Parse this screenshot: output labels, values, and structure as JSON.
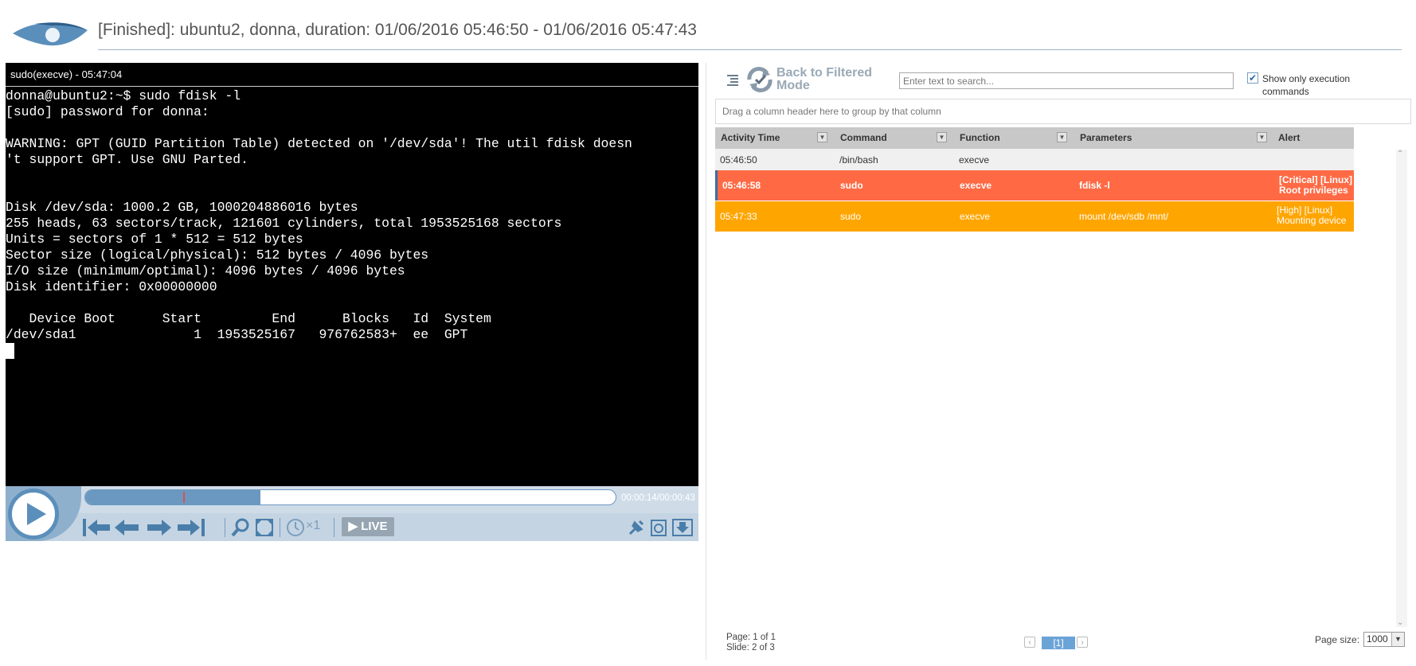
{
  "header": {
    "title": "[Finished]: ubuntu2, donna, duration: 01/06/2016 05:46:50 - 01/06/2016 05:47:43"
  },
  "player": {
    "titlebar": "sudo(execve) - 05:47:04",
    "terminal_text": "donna@ubuntu2:~$ sudo fdisk -l\n[sudo] password for donna:\n\nWARNING: GPT (GUID Partition Table) detected on '/dev/sda'! The util fdisk doesn\n't support GPT. Use GNU Parted.\n\n\nDisk /dev/sda: 1000.2 GB, 1000204886016 bytes\n255 heads, 63 sectors/track, 121601 cylinders, total 1953525168 sectors\nUnits = sectors of 1 * 512 = 512 bytes\nSector size (logical/physical): 512 bytes / 4096 bytes\nI/O size (minimum/optimal): 4096 bytes / 4096 bytes\nDisk identifier: 0x00000000\n\n   Device Boot      Start         End      Blocks   Id  System\n/dev/sda1               1  1953525167   976762583+  ee  GPT",
    "time": "00:00:14/00:00:43",
    "progress": 0.33,
    "speed": "×1",
    "live_label": "LIVE",
    "icons": [
      "play-icon",
      "skip-to-start-icon",
      "step-back-icon",
      "step-forward-icon",
      "skip-to-end-icon",
      "zoom-icon",
      "fullscreen-icon",
      "speed-clock-icon",
      "live-icon",
      "pin-icon",
      "screenshot-icon",
      "download-icon"
    ]
  },
  "panel": {
    "back_label_line1": "Back to Filtered",
    "back_label_line2": "Mode",
    "search_placeholder": "Enter text to search...",
    "show_exec_label": "Show only execution commands",
    "show_exec_checked": true,
    "group_hint": "Drag a column header here to group by that column",
    "columns": [
      "Activity Time",
      "Command",
      "Function",
      "Parameters",
      "Alert"
    ],
    "rows": [
      {
        "time": "05:46:50",
        "command": "/bin/bash",
        "function": "execve",
        "parameters": "",
        "alert_line1": "",
        "alert_line2": "",
        "color": "#f0f0f0"
      },
      {
        "time": "05:46:58",
        "command": "sudo",
        "function": "execve",
        "parameters": "fdisk -l",
        "alert_line1": "[Critical] [Linux]",
        "alert_line2": "Root privileges",
        "color": "#ff6a45"
      },
      {
        "time": "05:47:33",
        "command": "sudo",
        "function": "execve",
        "parameters": "mount /dev/sdb /mnt/",
        "alert_line1": "[High] [Linux]",
        "alert_line2": "Mounting device",
        "color": "#ffa500"
      }
    ],
    "pager": {
      "page_status": "Page: 1 of 1",
      "slide_status": "Slide: 2 of 3",
      "current_page": "[1]",
      "page_size_label": "Page size:",
      "page_size_value": "1000"
    }
  }
}
